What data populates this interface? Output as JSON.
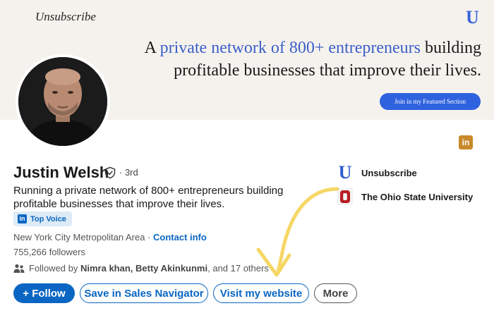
{
  "banner": {
    "brand": "Unsubscribe",
    "logo_letter": "U",
    "headline_prefix": "A ",
    "headline_accent": "private network of 800+ entrepreneurs",
    "headline_suffix": " building",
    "headline_line2": "profitable businesses that improve their lives.",
    "cta_label": "Join in my Featured Section",
    "accent_color": "#3b5fc7"
  },
  "profile": {
    "name": "Justin Welsh",
    "degree": "· 3rd",
    "tagline": "Running a private network of 800+ entrepreneurs building profitable businesses that improve their lives.",
    "badge_label": "Top Voice",
    "location": "New York City Metropolitan Area · ",
    "contact_link": "Contact info",
    "followers": "755,266 followers",
    "followed_prefix": "Followed by ",
    "followed_names": "Nimra khan, Betty Akinkunmi",
    "followed_suffix": ", and 17 others"
  },
  "experience": [
    {
      "label": "Unsubscribe",
      "logo_letter": "U"
    },
    {
      "label": "The Ohio State University",
      "logo": "ohio-state-logo"
    }
  ],
  "actions": {
    "follow": "+ Follow",
    "save_sales": "Save in Sales Navigator",
    "visit_website": "Visit my website",
    "more": "More"
  },
  "icons": {
    "linkedin_badge": "in",
    "verify": "shield-check-icon",
    "people": "people-icon",
    "arrow": "hand-drawn-arrow"
  },
  "colors": {
    "linkedin_blue": "#0a66c2",
    "banner_bg": "#f5f2ee",
    "arrow_yellow": "#f6d766",
    "ohio_red": "#b81c22"
  }
}
